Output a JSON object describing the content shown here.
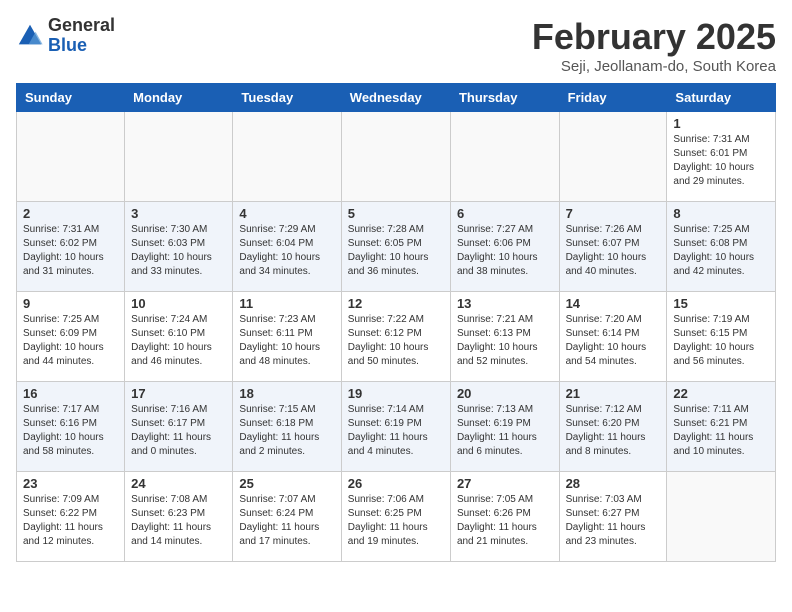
{
  "logo": {
    "general": "General",
    "blue": "Blue"
  },
  "title": "February 2025",
  "location": "Seji, Jeollanam-do, South Korea",
  "days_of_week": [
    "Sunday",
    "Monday",
    "Tuesday",
    "Wednesday",
    "Thursday",
    "Friday",
    "Saturday"
  ],
  "weeks": [
    [
      {
        "day": "",
        "info": ""
      },
      {
        "day": "",
        "info": ""
      },
      {
        "day": "",
        "info": ""
      },
      {
        "day": "",
        "info": ""
      },
      {
        "day": "",
        "info": ""
      },
      {
        "day": "",
        "info": ""
      },
      {
        "day": "1",
        "info": "Sunrise: 7:31 AM\nSunset: 6:01 PM\nDaylight: 10 hours\nand 29 minutes."
      }
    ],
    [
      {
        "day": "2",
        "info": "Sunrise: 7:31 AM\nSunset: 6:02 PM\nDaylight: 10 hours\nand 31 minutes."
      },
      {
        "day": "3",
        "info": "Sunrise: 7:30 AM\nSunset: 6:03 PM\nDaylight: 10 hours\nand 33 minutes."
      },
      {
        "day": "4",
        "info": "Sunrise: 7:29 AM\nSunset: 6:04 PM\nDaylight: 10 hours\nand 34 minutes."
      },
      {
        "day": "5",
        "info": "Sunrise: 7:28 AM\nSunset: 6:05 PM\nDaylight: 10 hours\nand 36 minutes."
      },
      {
        "day": "6",
        "info": "Sunrise: 7:27 AM\nSunset: 6:06 PM\nDaylight: 10 hours\nand 38 minutes."
      },
      {
        "day": "7",
        "info": "Sunrise: 7:26 AM\nSunset: 6:07 PM\nDaylight: 10 hours\nand 40 minutes."
      },
      {
        "day": "8",
        "info": "Sunrise: 7:25 AM\nSunset: 6:08 PM\nDaylight: 10 hours\nand 42 minutes."
      }
    ],
    [
      {
        "day": "9",
        "info": "Sunrise: 7:25 AM\nSunset: 6:09 PM\nDaylight: 10 hours\nand 44 minutes."
      },
      {
        "day": "10",
        "info": "Sunrise: 7:24 AM\nSunset: 6:10 PM\nDaylight: 10 hours\nand 46 minutes."
      },
      {
        "day": "11",
        "info": "Sunrise: 7:23 AM\nSunset: 6:11 PM\nDaylight: 10 hours\nand 48 minutes."
      },
      {
        "day": "12",
        "info": "Sunrise: 7:22 AM\nSunset: 6:12 PM\nDaylight: 10 hours\nand 50 minutes."
      },
      {
        "day": "13",
        "info": "Sunrise: 7:21 AM\nSunset: 6:13 PM\nDaylight: 10 hours\nand 52 minutes."
      },
      {
        "day": "14",
        "info": "Sunrise: 7:20 AM\nSunset: 6:14 PM\nDaylight: 10 hours\nand 54 minutes."
      },
      {
        "day": "15",
        "info": "Sunrise: 7:19 AM\nSunset: 6:15 PM\nDaylight: 10 hours\nand 56 minutes."
      }
    ],
    [
      {
        "day": "16",
        "info": "Sunrise: 7:17 AM\nSunset: 6:16 PM\nDaylight: 10 hours\nand 58 minutes."
      },
      {
        "day": "17",
        "info": "Sunrise: 7:16 AM\nSunset: 6:17 PM\nDaylight: 11 hours\nand 0 minutes."
      },
      {
        "day": "18",
        "info": "Sunrise: 7:15 AM\nSunset: 6:18 PM\nDaylight: 11 hours\nand 2 minutes."
      },
      {
        "day": "19",
        "info": "Sunrise: 7:14 AM\nSunset: 6:19 PM\nDaylight: 11 hours\nand 4 minutes."
      },
      {
        "day": "20",
        "info": "Sunrise: 7:13 AM\nSunset: 6:19 PM\nDaylight: 11 hours\nand 6 minutes."
      },
      {
        "day": "21",
        "info": "Sunrise: 7:12 AM\nSunset: 6:20 PM\nDaylight: 11 hours\nand 8 minutes."
      },
      {
        "day": "22",
        "info": "Sunrise: 7:11 AM\nSunset: 6:21 PM\nDaylight: 11 hours\nand 10 minutes."
      }
    ],
    [
      {
        "day": "23",
        "info": "Sunrise: 7:09 AM\nSunset: 6:22 PM\nDaylight: 11 hours\nand 12 minutes."
      },
      {
        "day": "24",
        "info": "Sunrise: 7:08 AM\nSunset: 6:23 PM\nDaylight: 11 hours\nand 14 minutes."
      },
      {
        "day": "25",
        "info": "Sunrise: 7:07 AM\nSunset: 6:24 PM\nDaylight: 11 hours\nand 17 minutes."
      },
      {
        "day": "26",
        "info": "Sunrise: 7:06 AM\nSunset: 6:25 PM\nDaylight: 11 hours\nand 19 minutes."
      },
      {
        "day": "27",
        "info": "Sunrise: 7:05 AM\nSunset: 6:26 PM\nDaylight: 11 hours\nand 21 minutes."
      },
      {
        "day": "28",
        "info": "Sunrise: 7:03 AM\nSunset: 6:27 PM\nDaylight: 11 hours\nand 23 minutes."
      },
      {
        "day": "",
        "info": ""
      }
    ]
  ]
}
